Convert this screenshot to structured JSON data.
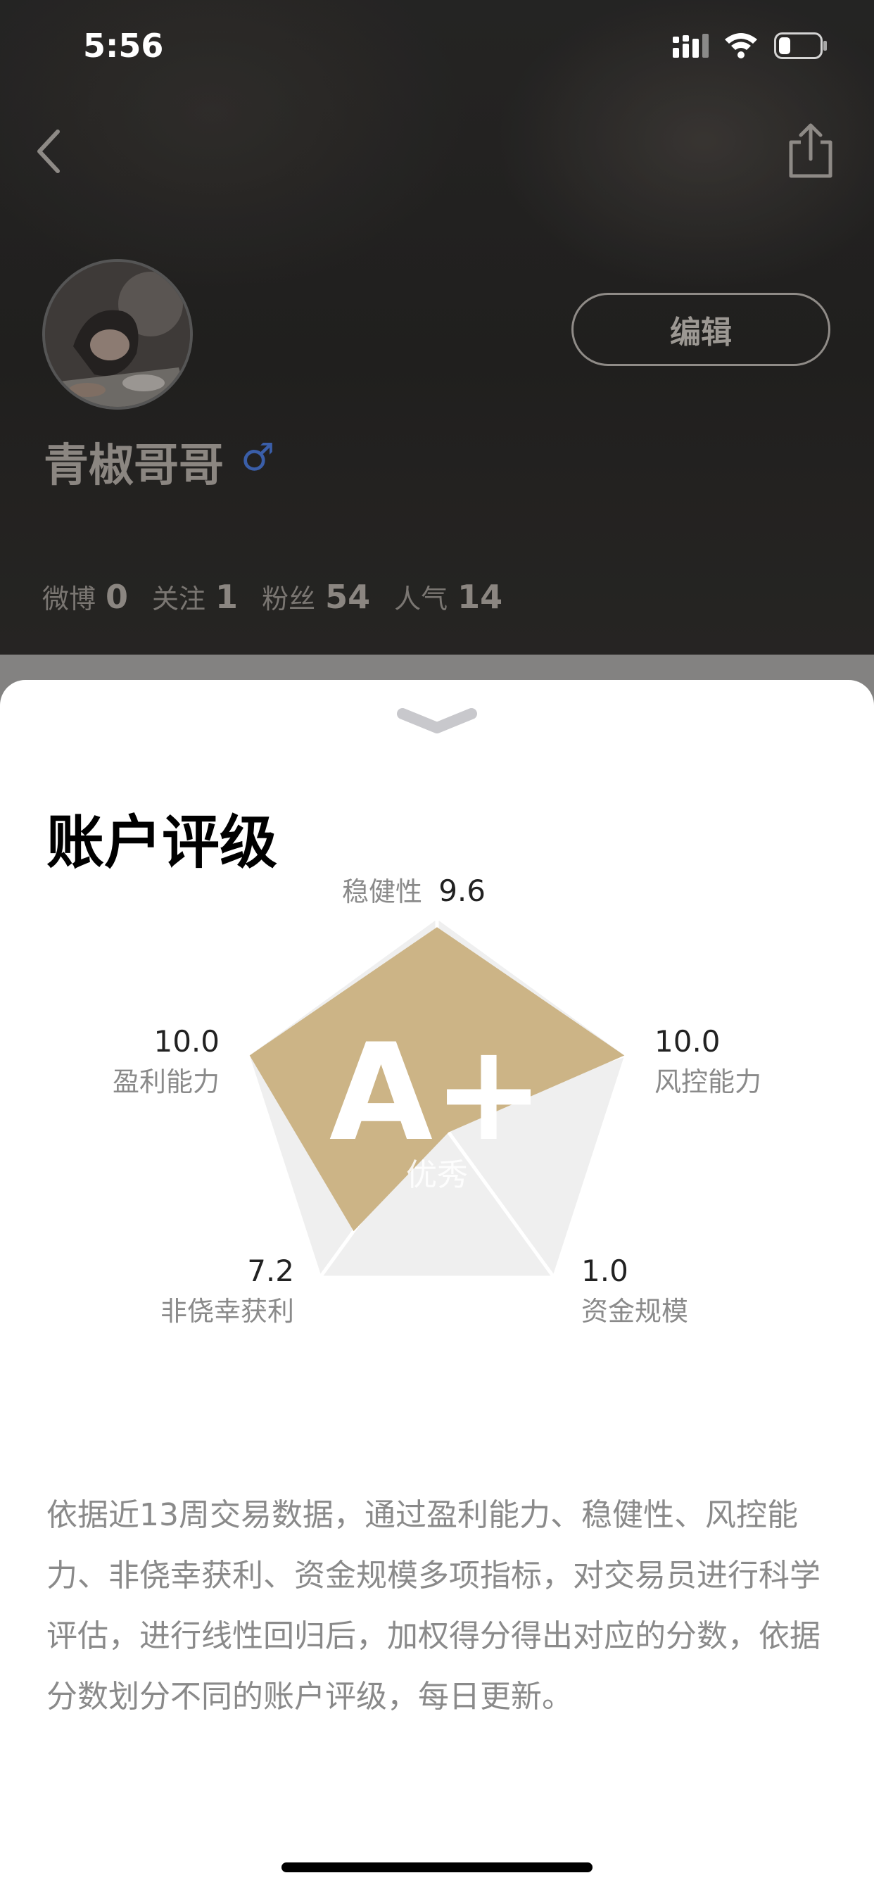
{
  "status_bar": {
    "time": "5:56",
    "icons": [
      "signal-icon",
      "wifi-icon",
      "battery-icon"
    ]
  },
  "nav": {
    "back_icon": "chevron-left-icon",
    "share_icon": "share-icon"
  },
  "profile": {
    "username": "青椒哥哥",
    "gender_symbol": "♂",
    "edit_label": "编辑",
    "stats": [
      {
        "label": "微博",
        "value": "0"
      },
      {
        "label": "关注",
        "value": "1"
      },
      {
        "label": "粉丝",
        "value": "54"
      },
      {
        "label": "人气",
        "value": "14"
      }
    ]
  },
  "sheet": {
    "collapse_icon": "chevron-down-icon",
    "title": "账户评级",
    "grade": "A+",
    "grade_label": "优秀",
    "description": "依据近13周交易数据，通过盈利能力、稳健性、风控能力、非侥幸获利、资金规模多项指标，对交易员进行科学评估，进行线性回归后，加权得分得出对应的分数，依据分数划分不同的账户评级，每日更新。"
  },
  "colors": {
    "gold": "#CCB486",
    "radar_bg": "#EFEFEF",
    "text_gray": "#8A8A8A"
  },
  "chart_data": {
    "type": "radar",
    "max": 10,
    "axes": [
      {
        "label": "稳健性",
        "value": 9.6,
        "display": "9.6"
      },
      {
        "label": "风控能力",
        "value": 10.0,
        "display": "10.0"
      },
      {
        "label": "资金规模",
        "value": 1.0,
        "display": "1.0"
      },
      {
        "label": "非侥幸获利",
        "value": 7.2,
        "display": "7.2"
      },
      {
        "label": "盈利能力",
        "value": 10.0,
        "display": "10.0"
      }
    ]
  }
}
